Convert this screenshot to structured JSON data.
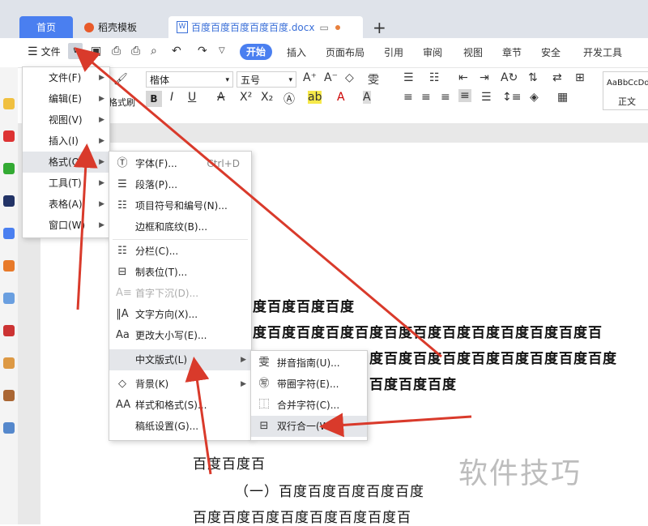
{
  "tabs": {
    "home": "首页",
    "templates": "稻壳模板",
    "document": "百度百度百度百度百度.docx"
  },
  "ribbon_tabs": {
    "file": "文件",
    "start": "开始",
    "insert": "插入",
    "layout": "页面布局",
    "references": "引用",
    "review": "审阅",
    "view": "视图",
    "chapter": "章节",
    "security": "安全",
    "dev_tools": "开发工具"
  },
  "toolbar": {
    "format_painter": "格式刷",
    "font_name": "楷体",
    "font_size": "五号",
    "style_sample": "AaBbCcDd",
    "style_name": "正文"
  },
  "file_menu": [
    {
      "label": "文件(F)"
    },
    {
      "label": "编辑(E)"
    },
    {
      "label": "视图(V)"
    },
    {
      "label": "插入(I)"
    },
    {
      "label": "格式(O)"
    },
    {
      "label": "工具(T)"
    },
    {
      "label": "表格(A)"
    },
    {
      "label": "窗口(W)"
    }
  ],
  "format_menu": [
    {
      "label": "字体(F)...",
      "shortcut": "Ctrl+D"
    },
    {
      "label": "段落(P)..."
    },
    {
      "label": "项目符号和编号(N)..."
    },
    {
      "label": "边框和底纹(B)..."
    },
    {
      "label": "分栏(C)..."
    },
    {
      "label": "制表位(T)..."
    },
    {
      "label": "首字下沉(D)..."
    },
    {
      "label": "文字方向(X)..."
    },
    {
      "label": "更改大小写(E)..."
    },
    {
      "label": "中文版式(L)"
    },
    {
      "label": "背景(K)"
    },
    {
      "label": "样式和格式(S)..."
    },
    {
      "label": "稿纸设置(G)..."
    }
  ],
  "chinese_layout_menu": [
    {
      "label": "拼音指南(U)..."
    },
    {
      "label": "带圈字符(E)..."
    },
    {
      "label": "合并字符(C)..."
    },
    {
      "label": "双行合一(W)..."
    }
  ],
  "document_lines": [
    "度百度百度百度",
    "度百度百度百度百度百度百度百度百度百度百度百度百",
    "度百度百度百度百度百度百度百度百度",
    "百度百度百度",
    "百度百度百",
    "（一）百度百度百度百度百度",
    "百度百度百度百度百度百度百度百"
  ],
  "watermark": "软件技巧",
  "colors": {
    "accent": "#4a7ff0",
    "annotation_arrow": "#d93a2b"
  }
}
